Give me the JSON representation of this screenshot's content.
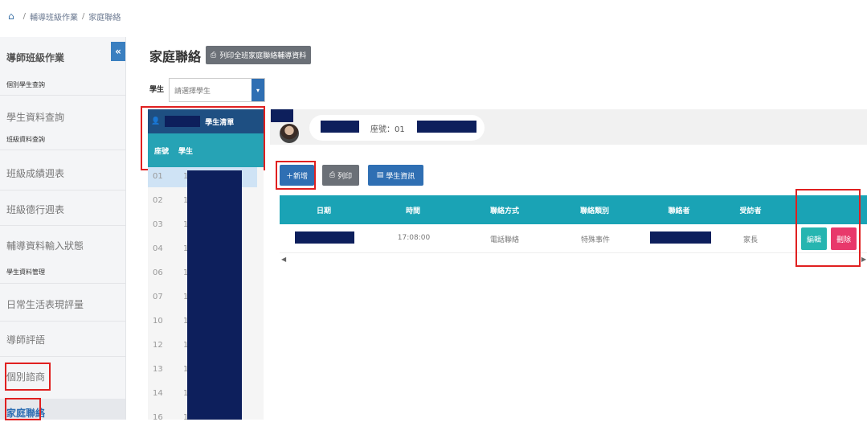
{
  "breadcrumb": {
    "items": [
      "輔導班級作業",
      "家庭聯絡"
    ]
  },
  "sidebar": {
    "collapse_icon": "«",
    "items": [
      {
        "label": "導師班級作業"
      },
      {
        "label": "個別學生查詢",
        "sub": true
      },
      {
        "label": "學生資料查詢"
      },
      {
        "label": "班級資料查詢",
        "sub": true
      },
      {
        "label": "班級成績週表"
      },
      {
        "label": "班級德行週表"
      },
      {
        "label": "輔導資料輸入狀態"
      },
      {
        "label": "學生資料管理",
        "sub": true
      },
      {
        "label": "日常生活表現評量"
      },
      {
        "label": "導師評語"
      },
      {
        "label": "個別諮商"
      },
      {
        "label": "家庭聯絡"
      }
    ]
  },
  "page": {
    "title": "家庭聯絡",
    "print_all_label": "列印全班家庭聯絡輔導資料",
    "student_label": "學生",
    "student_placeholder": "請選擇學生"
  },
  "student_list": {
    "header": "學生清單",
    "col_seat": "座號",
    "col_name": "學生",
    "rows": [
      "01",
      "02",
      "03",
      "04",
      "06",
      "07",
      "10",
      "12",
      "13",
      "14",
      "16"
    ],
    "name_prefix": "1"
  },
  "detail": {
    "seat_label": "座號：01"
  },
  "actions": {
    "add": "＋新增",
    "print": "列印",
    "info": "學生資訊"
  },
  "table": {
    "headers": [
      "日期",
      "時間",
      "聯絡方式",
      "聯絡類別",
      "聯絡者",
      "受訪者",
      ""
    ],
    "rows": [
      {
        "time": "17:08:00",
        "method": "電話聯絡",
        "category": "特殊事件",
        "interviewee": "家長",
        "edit": "編輯",
        "delete": "刪除"
      }
    ]
  },
  "colors": {
    "accent": "#1aa3b5",
    "navy": "#1e4f82",
    "mask": "#0d1f5c",
    "danger": "#e8386b",
    "highlight": "#e02020"
  }
}
